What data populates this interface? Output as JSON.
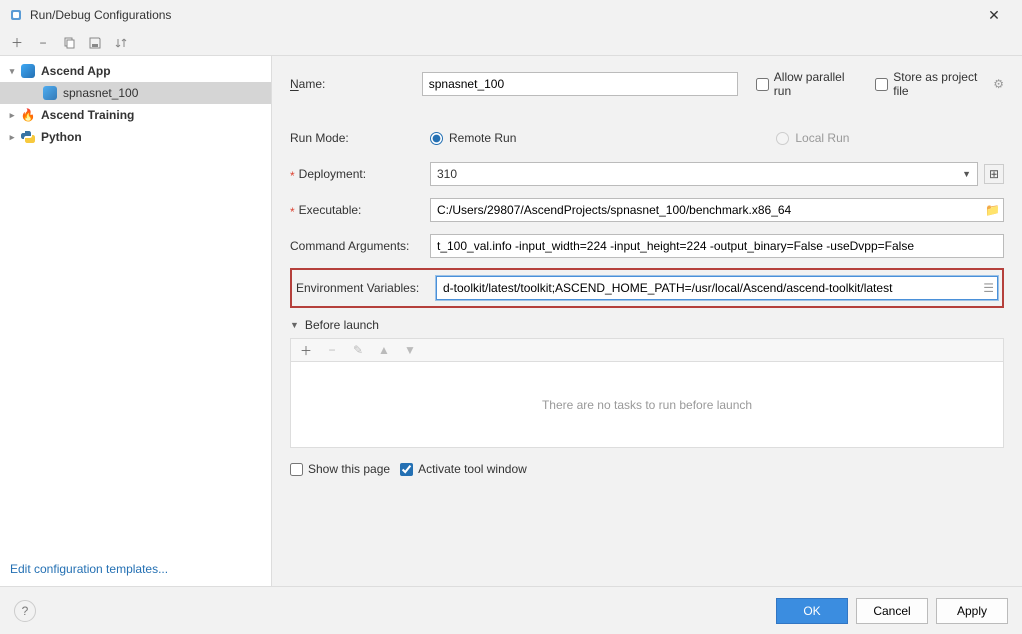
{
  "window": {
    "title": "Run/Debug Configurations"
  },
  "toolbar": {
    "add_tip": "+",
    "remove_tip": "−",
    "copy_tip": "copy",
    "save_tip": "save",
    "sort_tip": "sort"
  },
  "tree": {
    "items": [
      {
        "label": "Ascend App",
        "expanded": true
      },
      {
        "label": "spnasnet_100",
        "selected": true
      },
      {
        "label": "Ascend Training",
        "expanded": false
      },
      {
        "label": "Python",
        "expanded": false
      }
    ]
  },
  "sidebar_footer": {
    "templates_link": "Edit configuration templates..."
  },
  "form": {
    "name_label": "Name:",
    "name_value": "spnasnet_100",
    "allow_parallel_label": "Allow parallel run",
    "store_project_label": "Store as project file",
    "run_mode_label": "Run Mode:",
    "remote_run_label": "Remote Run",
    "local_run_label": "Local Run",
    "deployment_label": "Deployment:",
    "deployment_value": "310",
    "executable_label": "Executable:",
    "executable_value": "C:/Users/29807/AscendProjects/spnasnet_100/benchmark.x86_64",
    "cmdargs_label": "Command Arguments:",
    "cmdargs_value": "t_100_val.info -input_width=224 -input_height=224 -output_binary=False -useDvpp=False",
    "envvars_label": "Environment Variables:",
    "envvars_value": "d-toolkit/latest/toolkit;ASCEND_HOME_PATH=/usr/local/Ascend/ascend-toolkit/latest",
    "before_launch_label": "Before launch",
    "before_launch_empty": "There are no tasks to run before launch",
    "show_this_page": "Show this page",
    "activate_tool_window": "Activate tool window"
  },
  "footer": {
    "ok": "OK",
    "cancel": "Cancel",
    "apply": "Apply"
  }
}
